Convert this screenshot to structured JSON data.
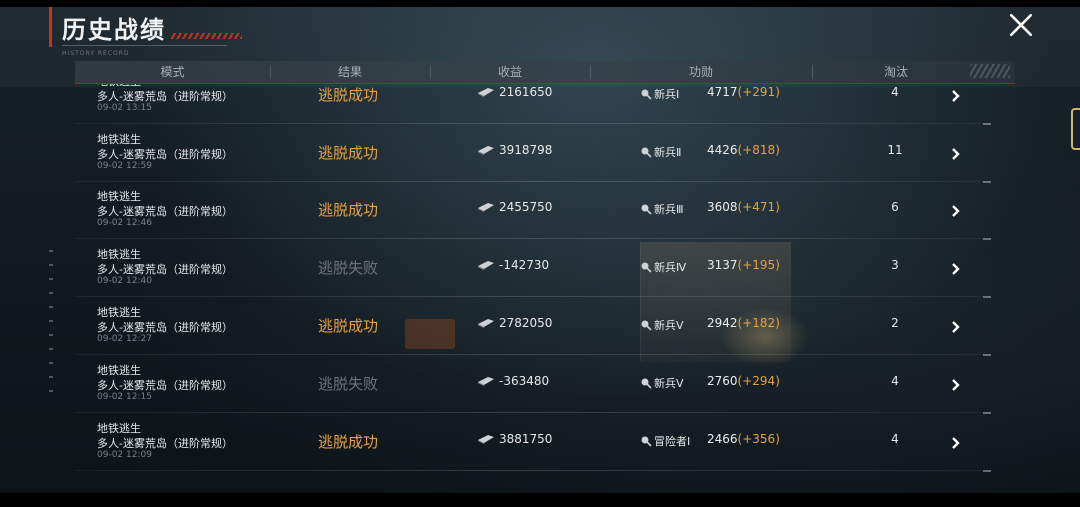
{
  "page": {
    "title": "历史战绩",
    "subtitle": "HISTORY RECORD"
  },
  "close": {
    "icon": "close-icon"
  },
  "columns": [
    "模式",
    "结果",
    "收益",
    "功勋",
    "淘汰"
  ],
  "colors": {
    "success": "#e8a23a",
    "fail": "#6e7378",
    "accent": "#c8331c",
    "delta": "#e8a23a"
  },
  "rows": [
    {
      "mode_type": "地铁逃生",
      "mode_map": "多人-迷雾荒岛（进阶常规）",
      "time": "09-02 13:15",
      "result": "逃脱成功",
      "result_status": "success",
      "income": "2161650",
      "rank": "新兵Ⅰ",
      "merit": "4717",
      "merit_delta": "(+291)",
      "kills": "4"
    },
    {
      "mode_type": "地铁逃生",
      "mode_map": "多人-迷雾荒岛（进阶常规）",
      "time": "09-02 12:59",
      "result": "逃脱成功",
      "result_status": "success",
      "income": "3918798",
      "rank": "新兵Ⅱ",
      "merit": "4426",
      "merit_delta": "(+818)",
      "kills": "11"
    },
    {
      "mode_type": "地铁逃生",
      "mode_map": "多人-迷雾荒岛（进阶常规）",
      "time": "09-02 12:46",
      "result": "逃脱成功",
      "result_status": "success",
      "income": "2455750",
      "rank": "新兵Ⅲ",
      "merit": "3608",
      "merit_delta": "(+471)",
      "kills": "6"
    },
    {
      "mode_type": "地铁逃生",
      "mode_map": "多人-迷雾荒岛（进阶常规）",
      "time": "09-02 12:40",
      "result": "逃脱失败",
      "result_status": "fail",
      "income": "-142730",
      "rank": "新兵Ⅳ",
      "merit": "3137",
      "merit_delta": "(+195)",
      "kills": "3"
    },
    {
      "mode_type": "地铁逃生",
      "mode_map": "多人-迷雾荒岛（进阶常规）",
      "time": "09-02 12:27",
      "result": "逃脱成功",
      "result_status": "success",
      "income": "2782050",
      "rank": "新兵Ⅴ",
      "merit": "2942",
      "merit_delta": "(+182)",
      "kills": "2"
    },
    {
      "mode_type": "地铁逃生",
      "mode_map": "多人-迷雾荒岛（进阶常规）",
      "time": "09-02 12:15",
      "result": "逃脱失败",
      "result_status": "fail",
      "income": "-363480",
      "rank": "新兵Ⅴ",
      "merit": "2760",
      "merit_delta": "(+294)",
      "kills": "4"
    },
    {
      "mode_type": "地铁逃生",
      "mode_map": "多人-迷雾荒岛（进阶常规）",
      "time": "09-02 12:09",
      "result": "逃脱成功",
      "result_status": "success",
      "income": "3881750",
      "rank": "冒险者Ⅰ",
      "merit": "2466",
      "merit_delta": "(+356)",
      "kills": "4"
    }
  ]
}
